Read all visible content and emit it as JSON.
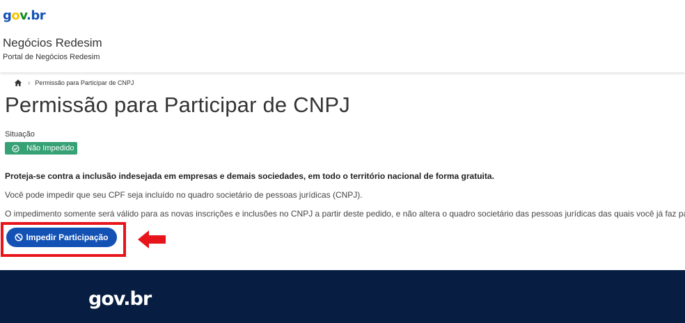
{
  "header": {
    "logo": {
      "g": "g",
      "o": "o",
      "v": "v",
      "dot": ".",
      "br": "br"
    },
    "title": "Negócios Redesim",
    "subtitle": "Portal de Negócios Redesim"
  },
  "breadcrumb": {
    "home_icon": "home-icon",
    "separator_icon": "chevron-right-icon",
    "current": "Permissão para Participar de CNPJ"
  },
  "main": {
    "title": "Permissão para Participar de CNPJ",
    "status_label": "Situação",
    "status_badge": "Não Impedido",
    "status_color": "#36a175",
    "intro_bold": "Proteja-se contra a inclusão indesejada em empresas e demais sociedades, em todo o território nacional de forma gratuita.",
    "paragraph_1": "Você pode impedir que seu CPF seja incluído no quadro societário de pessoas jurídicas (CNPJ).",
    "paragraph_2": "O impedimento somente será válido para as novas inscrições e inclusões no CNPJ a partir deste pedido, e não altera o quadro societário das pessoas jurídicas das quais você já faz parte.",
    "action_button": "Impedir Participação",
    "action_button_color": "#1351b4",
    "annotation_color": "#e8141b"
  },
  "footer": {
    "logo": "gov.br",
    "background": "#071d41"
  }
}
